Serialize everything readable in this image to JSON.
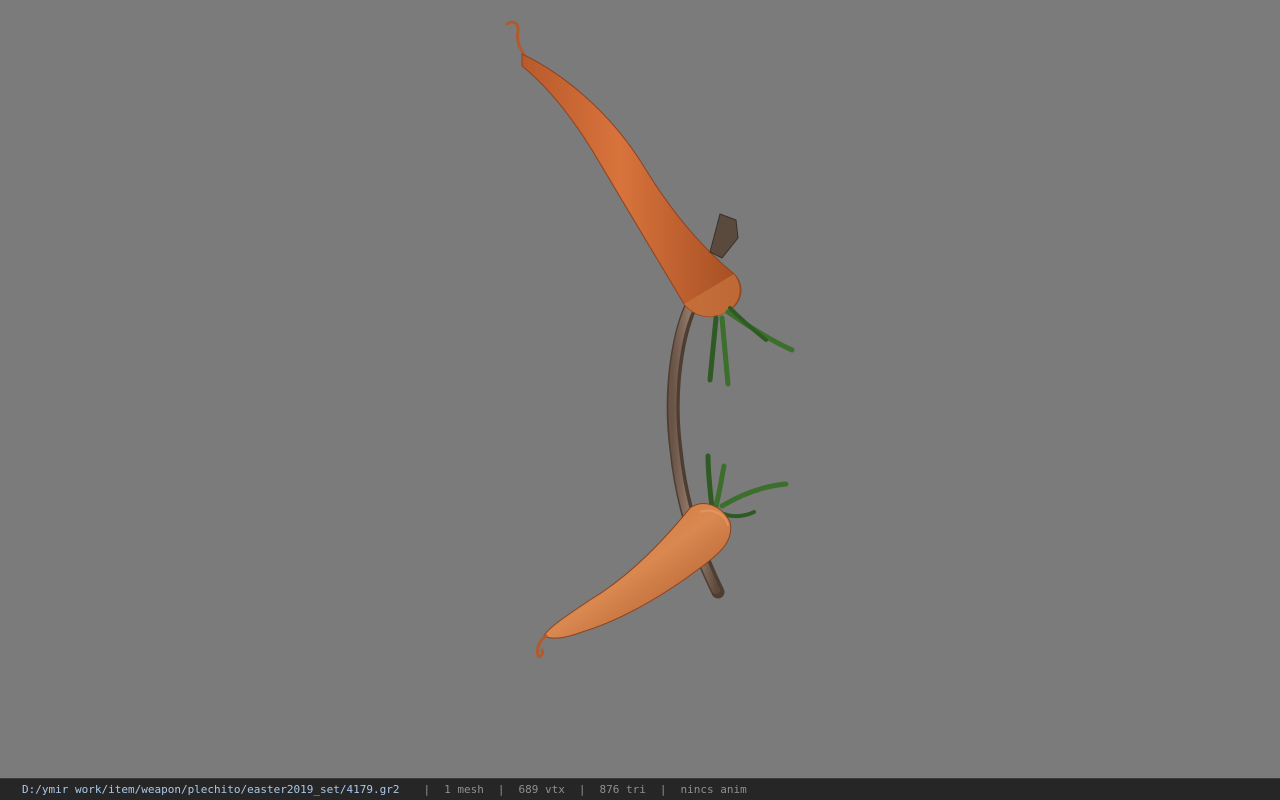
{
  "viewer": {
    "model_name": "carrot bow model",
    "background_color": "#7b7b7b"
  },
  "statusbar": {
    "path": "D:/ymir work/item/weapon/plechito/easter2019_set/4179.gr2",
    "meshes": "1 mesh",
    "vertices": "689 vtx",
    "triangles": "876 tri",
    "animation": "nincs anim",
    "separator": "|"
  }
}
